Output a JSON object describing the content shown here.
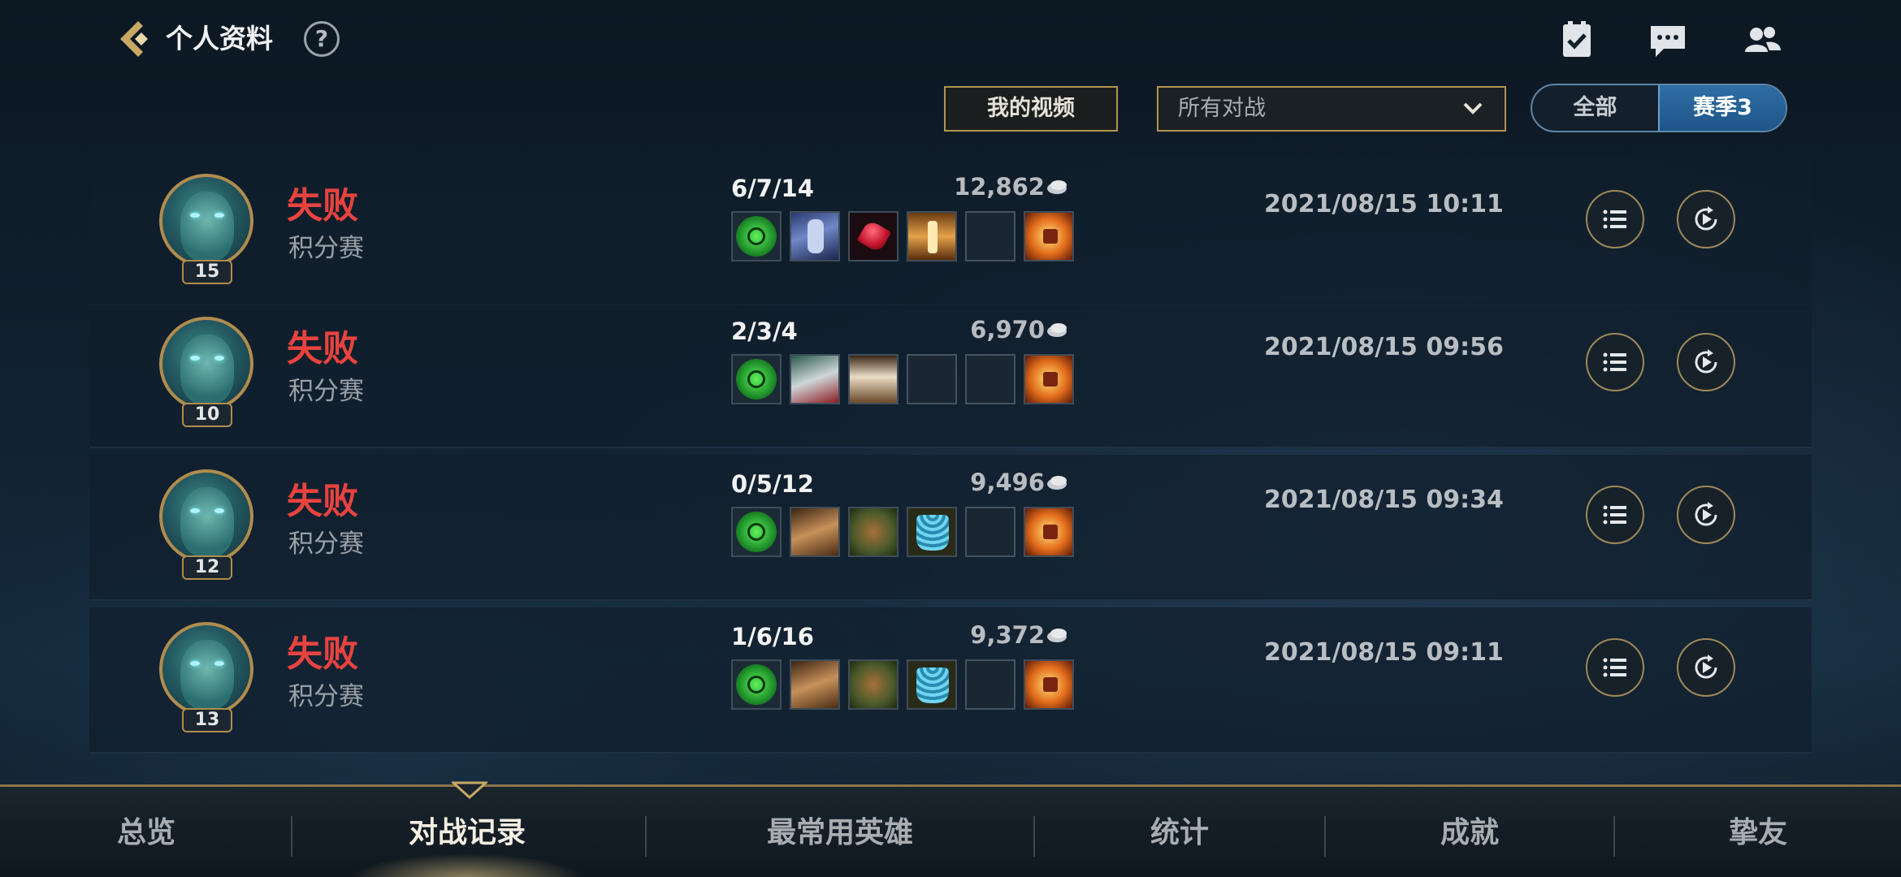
{
  "header": {
    "title": "个人资料",
    "help_glyph": "?",
    "icons": [
      "back-icon",
      "help-icon",
      "task-icon",
      "chat-icon",
      "friends-icon"
    ]
  },
  "filters": {
    "video_button": "我的视频",
    "match_type": "所有对战",
    "season_options": [
      "全部",
      "赛季3"
    ],
    "season_selected": "赛季3"
  },
  "matches": [
    {
      "result": "失败",
      "mode": "积分赛",
      "level": "15",
      "kda": "6/7/14",
      "gold": "12,862",
      "time": "2021/08/15 10:11"
    },
    {
      "result": "失败",
      "mode": "积分赛",
      "level": "10",
      "kda": "2/3/4",
      "gold": "6,970",
      "time": "2021/08/15 09:56"
    },
    {
      "result": "失败",
      "mode": "积分赛",
      "level": "12",
      "kda": "0/5/12",
      "gold": "9,496",
      "time": "2021/08/15 09:34"
    },
    {
      "result": "失败",
      "mode": "积分赛",
      "level": "13",
      "kda": "1/6/16",
      "gold": "9,372",
      "time": "2021/08/15 09:11"
    }
  ],
  "nav": {
    "tabs": [
      "总览",
      "对战记录",
      "最常用英雄",
      "统计",
      "成就",
      "挚友"
    ],
    "active": "对战记录"
  },
  "colors": {
    "defeat": "#e8433f",
    "gold_border": "#b49350",
    "season_active": "#2f6ea5"
  }
}
